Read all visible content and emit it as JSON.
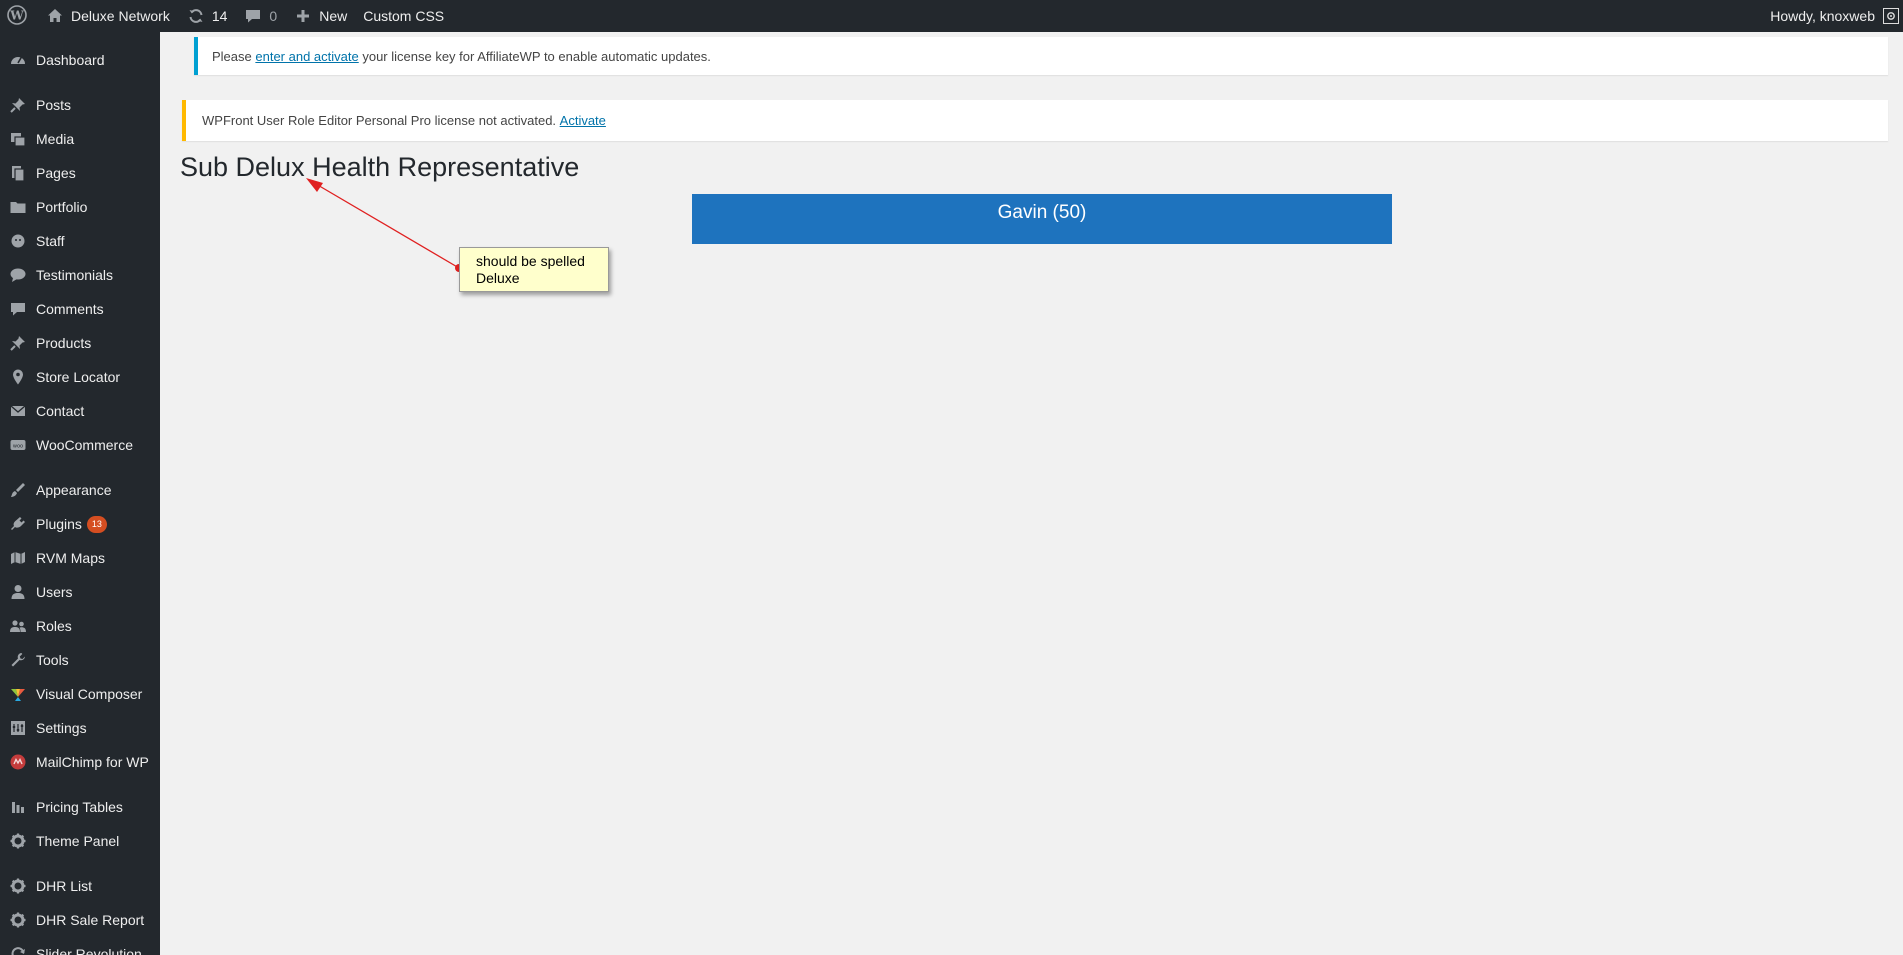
{
  "adminbar": {
    "site_name": "Deluxe Network",
    "updates_count": "14",
    "comments_count": "0",
    "new_label": "New",
    "custom_css_label": "Custom CSS",
    "howdy": "Howdy, knoxweb"
  },
  "sidebar": {
    "items": [
      {
        "label": "Dashboard",
        "icon": "dashboard-icon"
      },
      {
        "label": "Posts",
        "icon": "pin-icon"
      },
      {
        "label": "Media",
        "icon": "media-icon"
      },
      {
        "label": "Pages",
        "icon": "pages-icon"
      },
      {
        "label": "Portfolio",
        "icon": "folder-icon"
      },
      {
        "label": "Staff",
        "icon": "staff-icon"
      },
      {
        "label": "Testimonials",
        "icon": "speech-bubbles-icon"
      },
      {
        "label": "Comments",
        "icon": "comment-icon"
      },
      {
        "label": "Products",
        "icon": "pin-icon"
      },
      {
        "label": "Store Locator",
        "icon": "location-pin-icon"
      },
      {
        "label": "Contact",
        "icon": "envelope-icon"
      },
      {
        "label": "WooCommerce",
        "icon": "woocommerce-icon"
      },
      {
        "label": "Appearance",
        "icon": "paintbrush-icon"
      },
      {
        "label": "Plugins",
        "icon": "plugin-icon",
        "badge": "13"
      },
      {
        "label": "RVM Maps",
        "icon": "map-icon"
      },
      {
        "label": "Users",
        "icon": "user-icon"
      },
      {
        "label": "Roles",
        "icon": "group-icon"
      },
      {
        "label": "Tools",
        "icon": "wrench-icon"
      },
      {
        "label": "Visual Composer",
        "icon": "visual-composer-icon"
      },
      {
        "label": "Settings",
        "icon": "settings-icon"
      },
      {
        "label": "MailChimp for WP",
        "icon": "mailchimp-icon"
      },
      {
        "label": "Pricing Tables",
        "icon": "bar-chart-icon"
      },
      {
        "label": "Theme Panel",
        "icon": "gear-icon"
      },
      {
        "label": "DHR List",
        "icon": "gear-icon"
      },
      {
        "label": "DHR Sale Report",
        "icon": "gear-icon"
      },
      {
        "label": "Slider Revolution",
        "icon": "refresh-icon"
      }
    ]
  },
  "notices": {
    "affiliate": {
      "prefix": "Please ",
      "link": "enter and activate",
      "suffix": " your license key for AffiliateWP to enable automatic updates."
    },
    "wpfront": {
      "text": "WPFront User Role Editor Personal Pro license not activated. ",
      "link": "Activate"
    }
  },
  "main": {
    "title": "Sub Delux Health Representative",
    "rep_bar_label": "Gavin (50)"
  },
  "annotation": {
    "note": "should be spelled Deluxe"
  },
  "colors": {
    "adminbar_bg": "#23282d",
    "content_bg": "#f1f1f1",
    "rep_bar": "#1e73be",
    "info_border": "#00a0d2",
    "warning_border": "#ffb900",
    "badge": "#d54e21",
    "link": "#0073aa"
  }
}
